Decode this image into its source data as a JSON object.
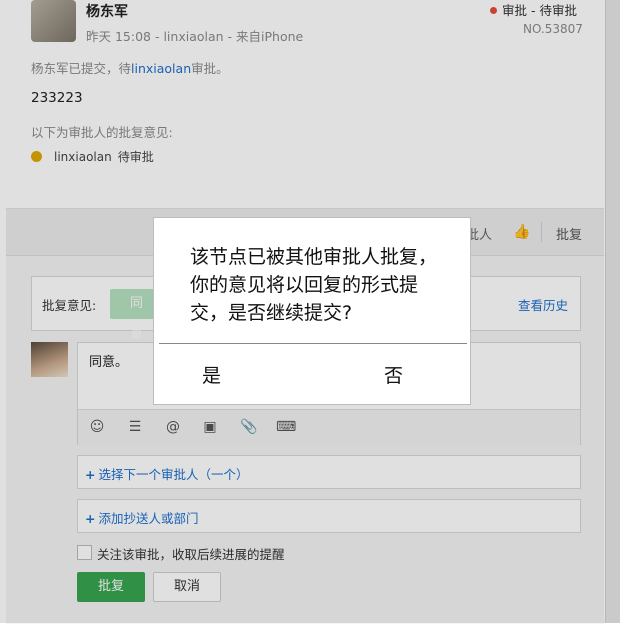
{
  "header": {
    "name": "杨东军",
    "meta": "昨天 15:08 - linxiaolan - 来自iPhone",
    "status": "审批 - 待审批",
    "status_color": "#e74c3c",
    "number": "NO.53807"
  },
  "body": {
    "submitted_prefix": "杨东军已提交，待",
    "submitted_link": "linxiaolan",
    "submitted_suffix": "审批。",
    "content": "233223",
    "approvers_heading": "以下为审批人的批复意见:",
    "approver_name": "linxiaolan",
    "approver_status": "待审批",
    "pending_icon_color": "#e0a800"
  },
  "actionbar": {
    "partial_label": "批人",
    "like_icon": "thumbs-up-icon",
    "approve_label": "批复"
  },
  "opinion": {
    "label": "批复意见:",
    "agree_chip": "同意",
    "history_link": "查看历史"
  },
  "comment": {
    "text": "同意。",
    "toolbar_icons": [
      "emoji-icon",
      "list-icon",
      "at-icon",
      "image-icon",
      "attachment-icon",
      "keyboard-icon"
    ]
  },
  "next_approver": "选择下一个审批人（一个）",
  "cc": "添加抄送人或部门",
  "follow_checkbox": "关注该审批，收取后续进展的提醒",
  "buttons": {
    "submit": "批复",
    "cancel": "取消"
  },
  "dialog": {
    "message": "该节点已被其他审批人批复，你的意见将以回复的形式提交，是否继续提交?",
    "yes": "是",
    "no": "否"
  }
}
